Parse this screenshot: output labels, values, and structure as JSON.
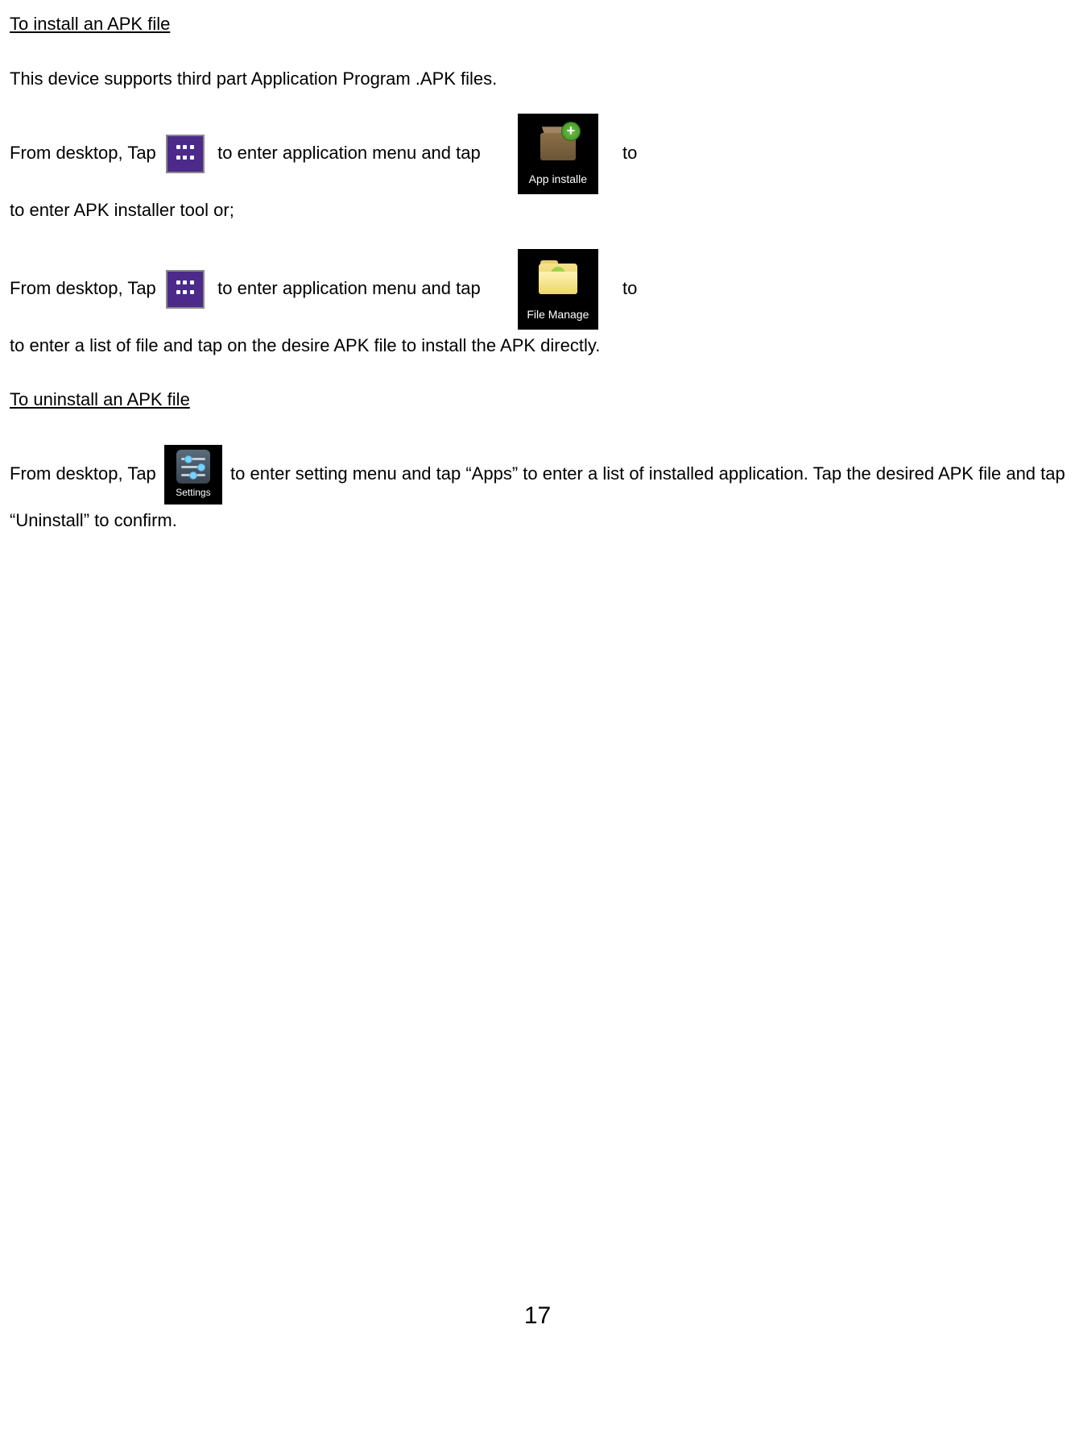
{
  "headings": {
    "install": "To install an APK file",
    "uninstall": "To uninstall an APK file"
  },
  "text": {
    "intro": "This device supports third part Application Program .APK files.",
    "fromDesktopTap": "From desktop, Tap",
    "toEnterAppMenuAndTap": "to enter application menu and tap",
    "toEnterInstaller": "to enter APK installer tool or;",
    "toEnterFileList": "to enter a list of file and tap on the desire APK file to install the APK directly.",
    "toWord": "to",
    "uninstallLine": "to enter setting menu and tap “Apps” to enter a list of installed application.    Tap the desired APK file and tap “Uninstall” to confirm."
  },
  "icons": {
    "appInstaller": "App installe",
    "fileManager": "File Manage",
    "settings": "Settings"
  },
  "pageNumber": "17"
}
